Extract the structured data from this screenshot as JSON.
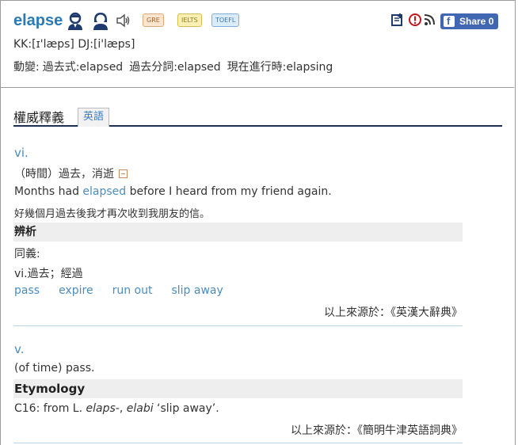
{
  "header": {
    "word": "elapse",
    "tags": [
      "GRE",
      "IELTS",
      "TOEFL"
    ],
    "share_label": "Share",
    "share_count": "0",
    "phonetic": "KK:[ɪ'læps] DJ:[i'læps]",
    "forms_label": "動變:",
    "forms": [
      "過去式:elapsed",
      "過去分詞:elapsed",
      "現在進行時:elapsing"
    ]
  },
  "tabs": {
    "main": "權威釋義",
    "active": "英語"
  },
  "entry1": {
    "pos": "vi.",
    "sense": "（時間）過去，消逝",
    "example_pre": "Months had ",
    "example_word": "elapsed",
    "example_post": " before I heard from my friend again.",
    "example_zh": "好幾個月過去後我才再次收到我朋友的信。",
    "analysis_title": "辨析",
    "synonym_label": "同義:",
    "synonym_sense": "vi.過去；經過",
    "synonyms": [
      "pass",
      "expire",
      "run out",
      "slip away"
    ],
    "source": "以上來源於：《英漢大辭典》"
  },
  "entry2": {
    "pos": "v.",
    "sense": "(of time) pass.",
    "etymology_title": "Etymology",
    "etym_pre": "C16: from L. ",
    "etym_it1": "elaps-",
    "etym_mid": ", ",
    "etym_it2": "elabi",
    "etym_post": " ‘slip away’.",
    "source": "以上來源於：《簡明牛津英語詞典》"
  }
}
